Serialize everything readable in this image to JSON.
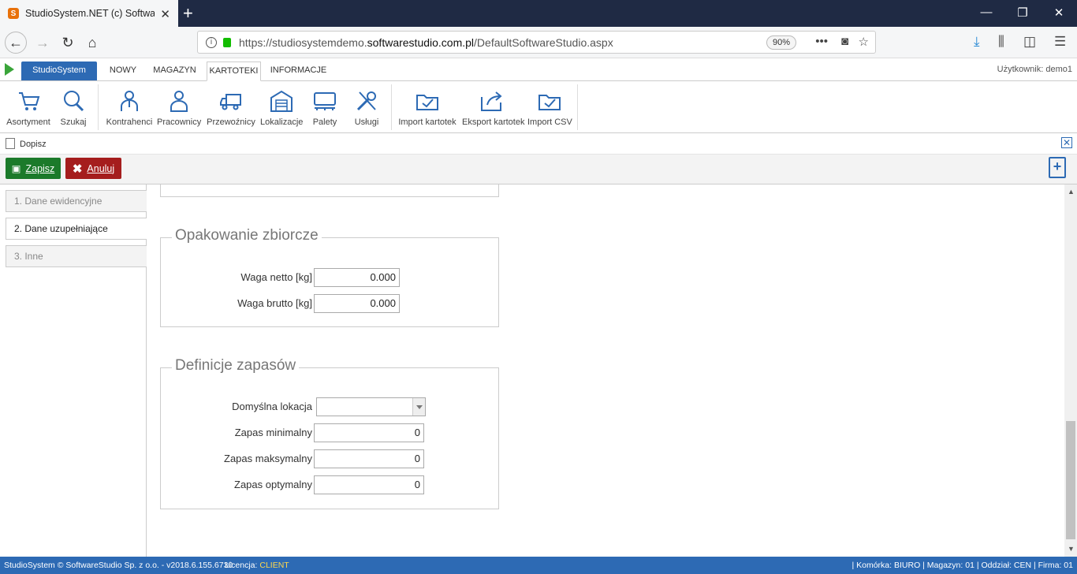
{
  "browser": {
    "tab_title": "StudioSystem.NET (c) Software",
    "favicon": "S",
    "url_prefix": "https://studiosystemdemo.",
    "url_domain": "softwarestudio.com.pl",
    "url_path": "/DefaultSoftwareStudio.aspx",
    "zoom": "90%"
  },
  "app": {
    "app_tab": "StudioSystem",
    "tabs": [
      "NOWY",
      "MAGAZYN",
      "KARTOTEKI",
      "INFORMACJE"
    ],
    "active_tab": "KARTOTEKI",
    "user_label": "Użytkownik: demo1"
  },
  "ribbon": {
    "buttons": [
      {
        "label": "Asortyment",
        "icon": "cart-icon"
      },
      {
        "label": "Szukaj",
        "icon": "search-icon"
      },
      {
        "label": "Kontrahenci",
        "icon": "contractor-icon"
      },
      {
        "label": "Pracownicy",
        "icon": "person-icon"
      },
      {
        "label": "Przewoźnicy",
        "icon": "truck-icon"
      },
      {
        "label": "Lokalizacje",
        "icon": "warehouse-icon"
      },
      {
        "label": "Palety",
        "icon": "pallet-icon"
      },
      {
        "label": "Usługi",
        "icon": "tools-icon"
      },
      {
        "label": "Import kartotek",
        "icon": "folder-import-icon"
      },
      {
        "label": "Eksport kartotek",
        "icon": "folder-export-icon"
      },
      {
        "label": "Import CSV",
        "icon": "folder-csv-icon"
      }
    ]
  },
  "form": {
    "title": "Dopisz",
    "save_label": "Zapisz",
    "cancel_label": "Anuluj"
  },
  "sidenav": {
    "items": [
      "1. Dane ewidencyjne",
      "2. Dane uzupełniające",
      "3. Inne"
    ],
    "active_index": 1
  },
  "opakowanie": {
    "legend": "Opakowanie zbiorcze",
    "net_label": "Waga netto [kg]",
    "net_value": "0.000",
    "gross_label": "Waga brutto [kg]",
    "gross_value": "0.000"
  },
  "zapasy": {
    "legend": "Definicje zapasów",
    "location_label": "Domyślna lokacja",
    "location_value": "",
    "min_label": "Zapas minimalny",
    "min_value": "0",
    "max_label": "Zapas maksymalny",
    "max_value": "0",
    "opt_label": "Zapas optymalny",
    "opt_value": "0"
  },
  "status": {
    "left": "StudioSystem © SoftwareStudio Sp. z o.o. - v2018.6.155.6730",
    "license_label": "Licencja:",
    "license_value": "CLIENT",
    "right": "| Komórka: BIURO | Magazyn: 01 | Oddział: CEN | Firma: 01"
  },
  "colors": {
    "accent": "#2d6ab4",
    "save": "#1b7a2a",
    "cancel": "#a51d1d"
  }
}
